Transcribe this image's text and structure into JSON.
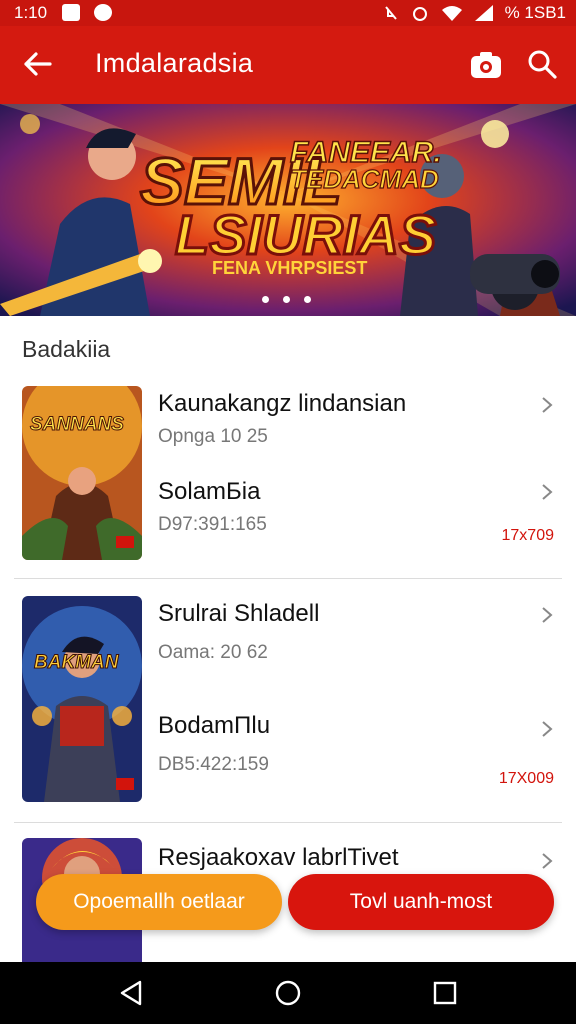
{
  "status_bar": {
    "time": "1:10",
    "right_text": "% 1SB1",
    "icons": [
      "mail-icon",
      "chat-icon",
      "mute-icon",
      "alarm-icon",
      "wifi-icon",
      "signal-icon"
    ]
  },
  "app_bar": {
    "title": "Imdalaradsia",
    "icons": [
      "back-arrow-icon",
      "camera-icon",
      "search-icon"
    ]
  },
  "banner": {
    "line1": "SEMIL",
    "line2": "FANEEAR.",
    "line3": "TEDACMAD",
    "line4": "LSIURIAS",
    "tag": "FENA VHRPSIEST",
    "dots_count": 3
  },
  "section": {
    "label": "Badakiia"
  },
  "items": [
    {
      "thumb_text": "SANNANS",
      "title": "Kaunakangz lindansian",
      "subtitle": "Opnga 10 25",
      "title2": "SolamБia",
      "subtitle2": "D97:391:165",
      "badge": "17x709",
      "thumb_colors": [
        "#f0a52c",
        "#7b3c1f"
      ]
    },
    {
      "thumb_text": "BAKMAN",
      "title": "Srulrai Shladell",
      "subtitle": "Oama: 20 62",
      "title2": "BodamΠlu",
      "subtitle2": "DB5:422:159",
      "badge": "17X009",
      "thumb_colors": [
        "#2d5aa8",
        "#1a1a3a"
      ]
    },
    {
      "title": "Resjaakoxav labrlTivet"
    }
  ],
  "actions": {
    "left_label": "Opoemallh oetlaar",
    "right_label": "Tovl uanh-most"
  },
  "nav": {
    "icons": [
      "back-triangle-icon",
      "home-circle-icon",
      "recents-square-icon"
    ]
  },
  "colors": {
    "primary": "#d41a10",
    "accent_orange": "#f59a1b",
    "badge_red": "#d2140c"
  }
}
